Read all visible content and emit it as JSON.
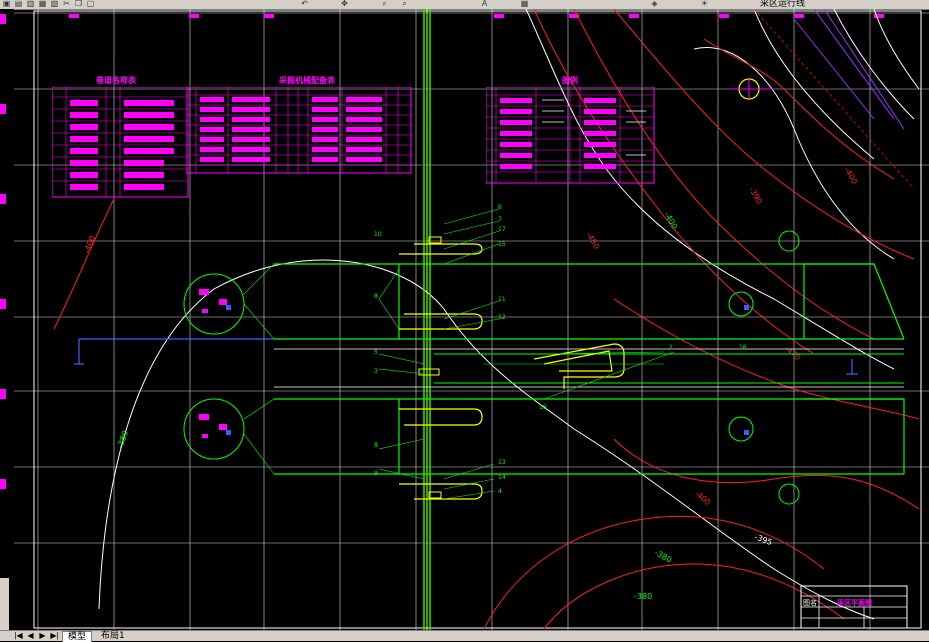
{
  "toolbar": {
    "layer_name": "采区运行线",
    "icons": [
      "open-icon",
      "save-icon",
      "print-icon",
      "preview-icon",
      "publish-icon",
      "cut-icon",
      "copy-icon",
      "paste-icon",
      "undo-icon",
      "pan-icon",
      "zoom-icon",
      "zoom-window-icon",
      "properties-icon",
      "text-style-icon",
      "layer-icon",
      "layer-state-icon"
    ]
  },
  "tables": {
    "left_title": "巷道名称表",
    "middle_title": "采掘机械配备表",
    "right_title": "图例"
  },
  "annotations": {
    "contour_labels": [
      "-400",
      "-380",
      "-450",
      "-400",
      "-390",
      "-380",
      "-400",
      "-395"
    ],
    "callouts": [
      "6",
      "7",
      "8",
      "9",
      "10",
      "11",
      "12",
      "13",
      "14",
      "15",
      "16",
      "17",
      "18"
    ]
  },
  "title_block": {
    "label": "图名",
    "value": "采区平面图"
  },
  "tabs": {
    "model": "模型",
    "layout1": "布局1"
  },
  "colors": {
    "background": "#000000",
    "green": "#00ff00",
    "yellow": "#ffff00",
    "magenta": "#ff00ff",
    "red": "#ff0000",
    "white": "#ffffff",
    "blue": "#0000ff"
  }
}
